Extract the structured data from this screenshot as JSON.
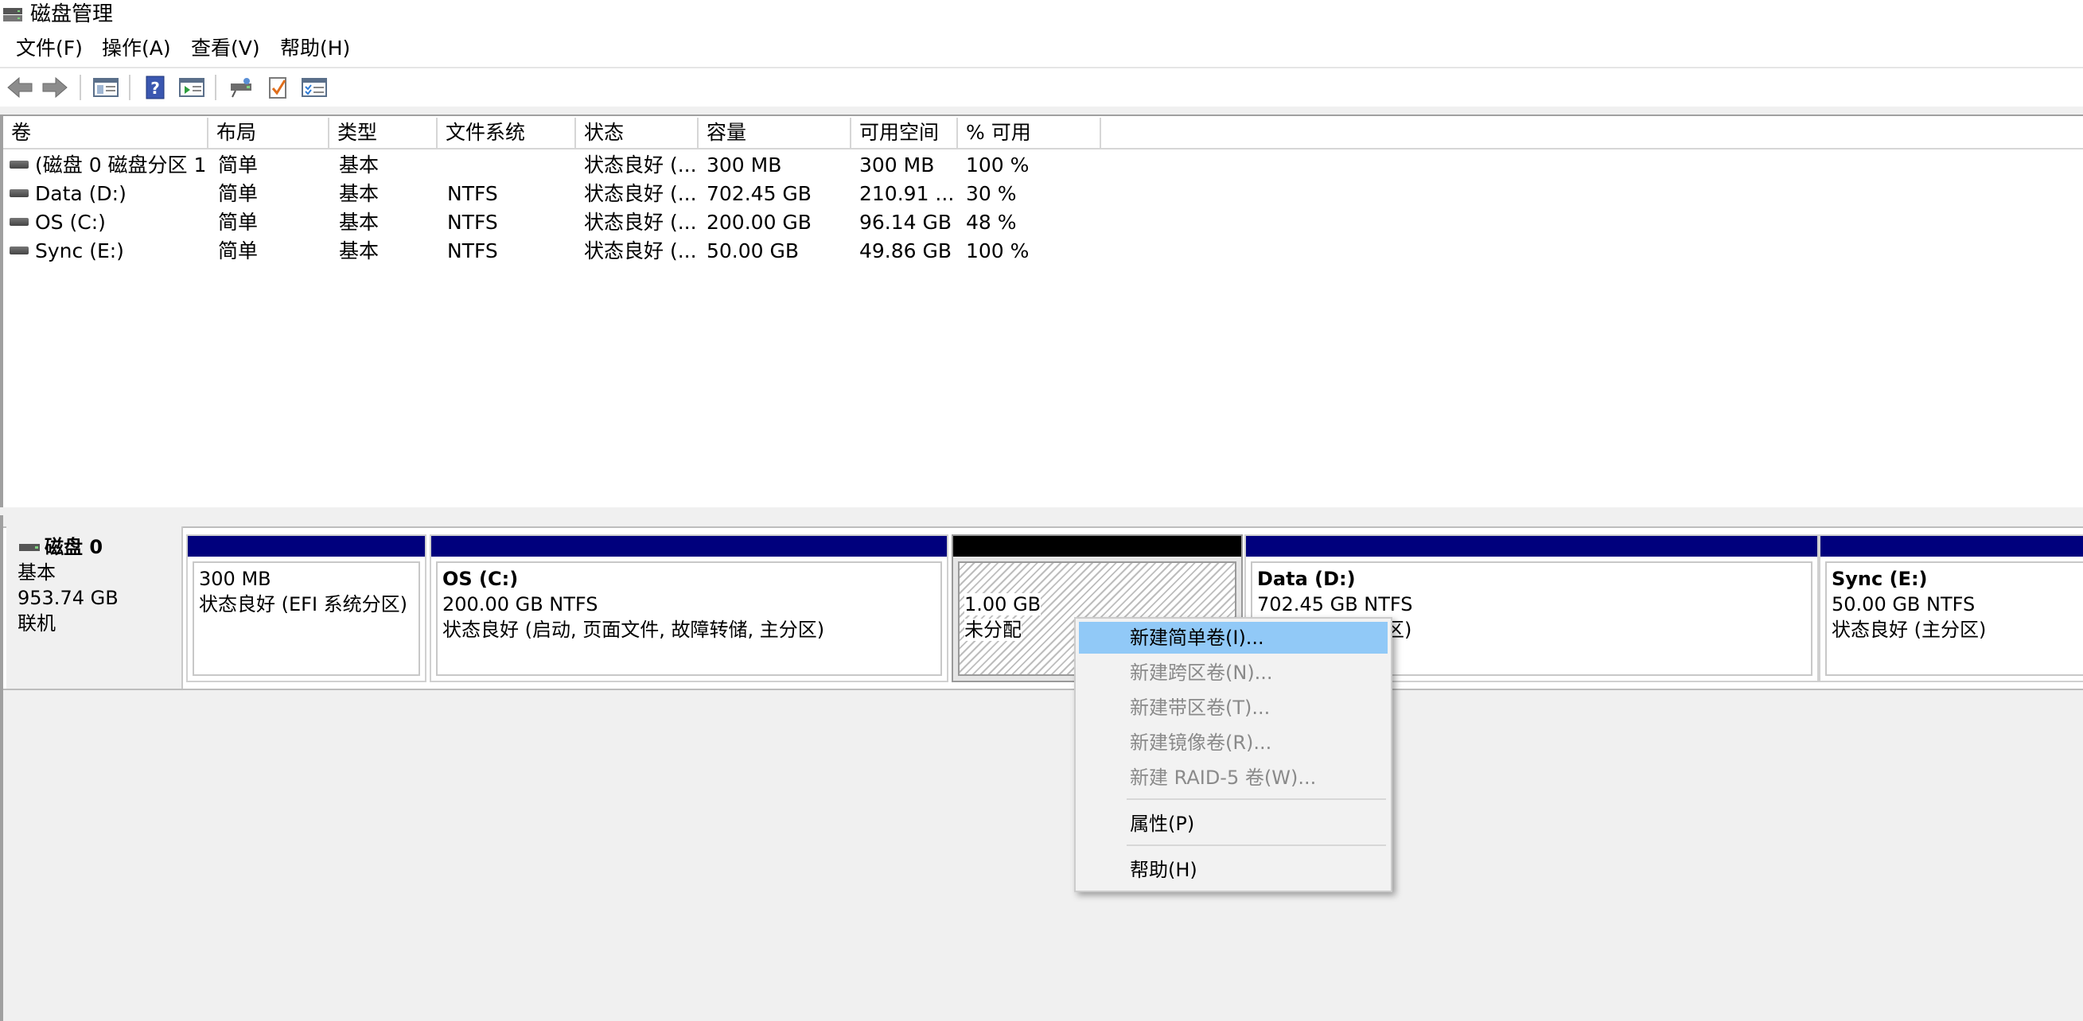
{
  "window": {
    "title": "磁盘管理"
  },
  "menu": [
    {
      "label": "文件(F)"
    },
    {
      "label": "操作(A)"
    },
    {
      "label": "查看(V)"
    },
    {
      "label": "帮助(H)"
    }
  ],
  "toolbar": {
    "buttons": [
      {
        "name": "back-arrow-icon"
      },
      {
        "name": "forward-arrow-icon"
      },
      {
        "name": "console-tree-icon"
      },
      {
        "name": "help-icon"
      },
      {
        "name": "show-action-pane-icon"
      },
      {
        "name": "connect-disk-icon"
      },
      {
        "name": "check-properties-icon"
      },
      {
        "name": "settings-list-icon"
      }
    ]
  },
  "columns": [
    "卷",
    "布局",
    "类型",
    "文件系统",
    "状态",
    "容量",
    "可用空间",
    "% 可用"
  ],
  "volumes": [
    {
      "name": "(磁盘 0 磁盘分区 1)",
      "layout": "简单",
      "type": "基本",
      "fs": "",
      "status": "状态良好 (...",
      "capacity": "300 MB",
      "free": "300 MB",
      "pct": "100 %"
    },
    {
      "name": "Data (D:)",
      "layout": "简单",
      "type": "基本",
      "fs": "NTFS",
      "status": "状态良好 (...",
      "capacity": "702.45 GB",
      "free": "210.91 ...",
      "pct": "30 %"
    },
    {
      "name": "OS (C:)",
      "layout": "简单",
      "type": "基本",
      "fs": "NTFS",
      "status": "状态良好 (...",
      "capacity": "200.00 GB",
      "free": "96.14 GB",
      "pct": "48 %"
    },
    {
      "name": "Sync (E:)",
      "layout": "简单",
      "type": "基本",
      "fs": "NTFS",
      "status": "状态良好 (...",
      "capacity": "50.00 GB",
      "free": "49.86 GB",
      "pct": "100 %"
    }
  ],
  "disk": {
    "name": "磁盘 0",
    "type": "基本",
    "size": "953.74 GB",
    "state": "联机"
  },
  "partitions": {
    "efi": {
      "size": "300 MB",
      "status": "状态良好 (EFI 系统分区)"
    },
    "os": {
      "name": "OS  (C:)",
      "size": "200.00 GB NTFS",
      "status": "状态良好 (启动, 页面文件, 故障转储, 主分区)"
    },
    "unalloc": {
      "size": "1.00 GB",
      "status": "未分配"
    },
    "data": {
      "name": "Data  (D:)",
      "size": "702.45 GB NTFS",
      "status": "状态良好 (主分区)"
    },
    "sync": {
      "name": "Sync  (E:)",
      "size": "50.00 GB NTFS",
      "status": "状态良好 (主分区)"
    }
  },
  "context_menu": {
    "items": [
      {
        "label": "新建简单卷(I)...",
        "enabled": true,
        "highlighted": true
      },
      {
        "label": "新建跨区卷(N)...",
        "enabled": false
      },
      {
        "label": "新建带区卷(T)...",
        "enabled": false
      },
      {
        "label": "新建镜像卷(R)...",
        "enabled": false
      },
      {
        "label": "新建 RAID-5 卷(W)...",
        "enabled": false
      },
      {
        "label": "属性(P)",
        "enabled": true
      },
      {
        "label": "帮助(H)",
        "enabled": true
      }
    ]
  },
  "colors": {
    "partition_bar": "#00007d",
    "unallocated_bar": "#000000",
    "menu_highlight": "#91c9f7"
  }
}
